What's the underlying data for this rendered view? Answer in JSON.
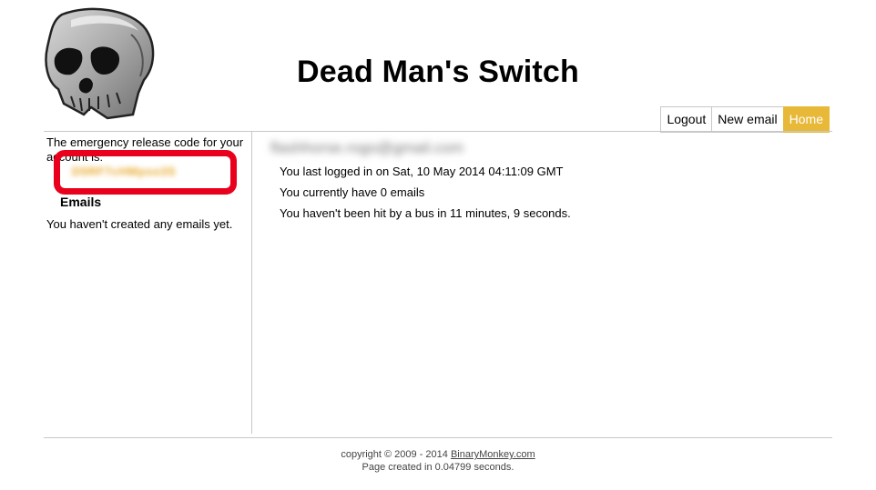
{
  "header": {
    "title": "Dead Man's Switch"
  },
  "nav": {
    "items": [
      "Logout",
      "New email",
      "Home"
    ],
    "active": "Home",
    "active_color": "#e8b838"
  },
  "sidebar": {
    "release_code_text": "The emergency release code for your account is:",
    "release_code_value": "D5RF7cHMpxo3S",
    "emails_heading": "Emails",
    "no_emails_text": "You haven't created any emails yet."
  },
  "main": {
    "user_email": "flashhorse.rogo@gmail.com",
    "last_login": "You last logged in on Sat, 10 May 2014 04:11:09 GMT",
    "email_count_text": "You currently have 0 emails",
    "bus_text": "You haven't been hit by a bus in 11 minutes, 9 seconds."
  },
  "footer": {
    "copyright_prefix": "copyright © 2009 - 2014 ",
    "copyright_link": "BinaryMonkey.com",
    "page_created": "Page created in 0.04799 seconds."
  },
  "colors": {
    "highlight": "#e8001c",
    "code": "#e8a828"
  },
  "icons": {
    "logo": "skull-logo-icon"
  }
}
